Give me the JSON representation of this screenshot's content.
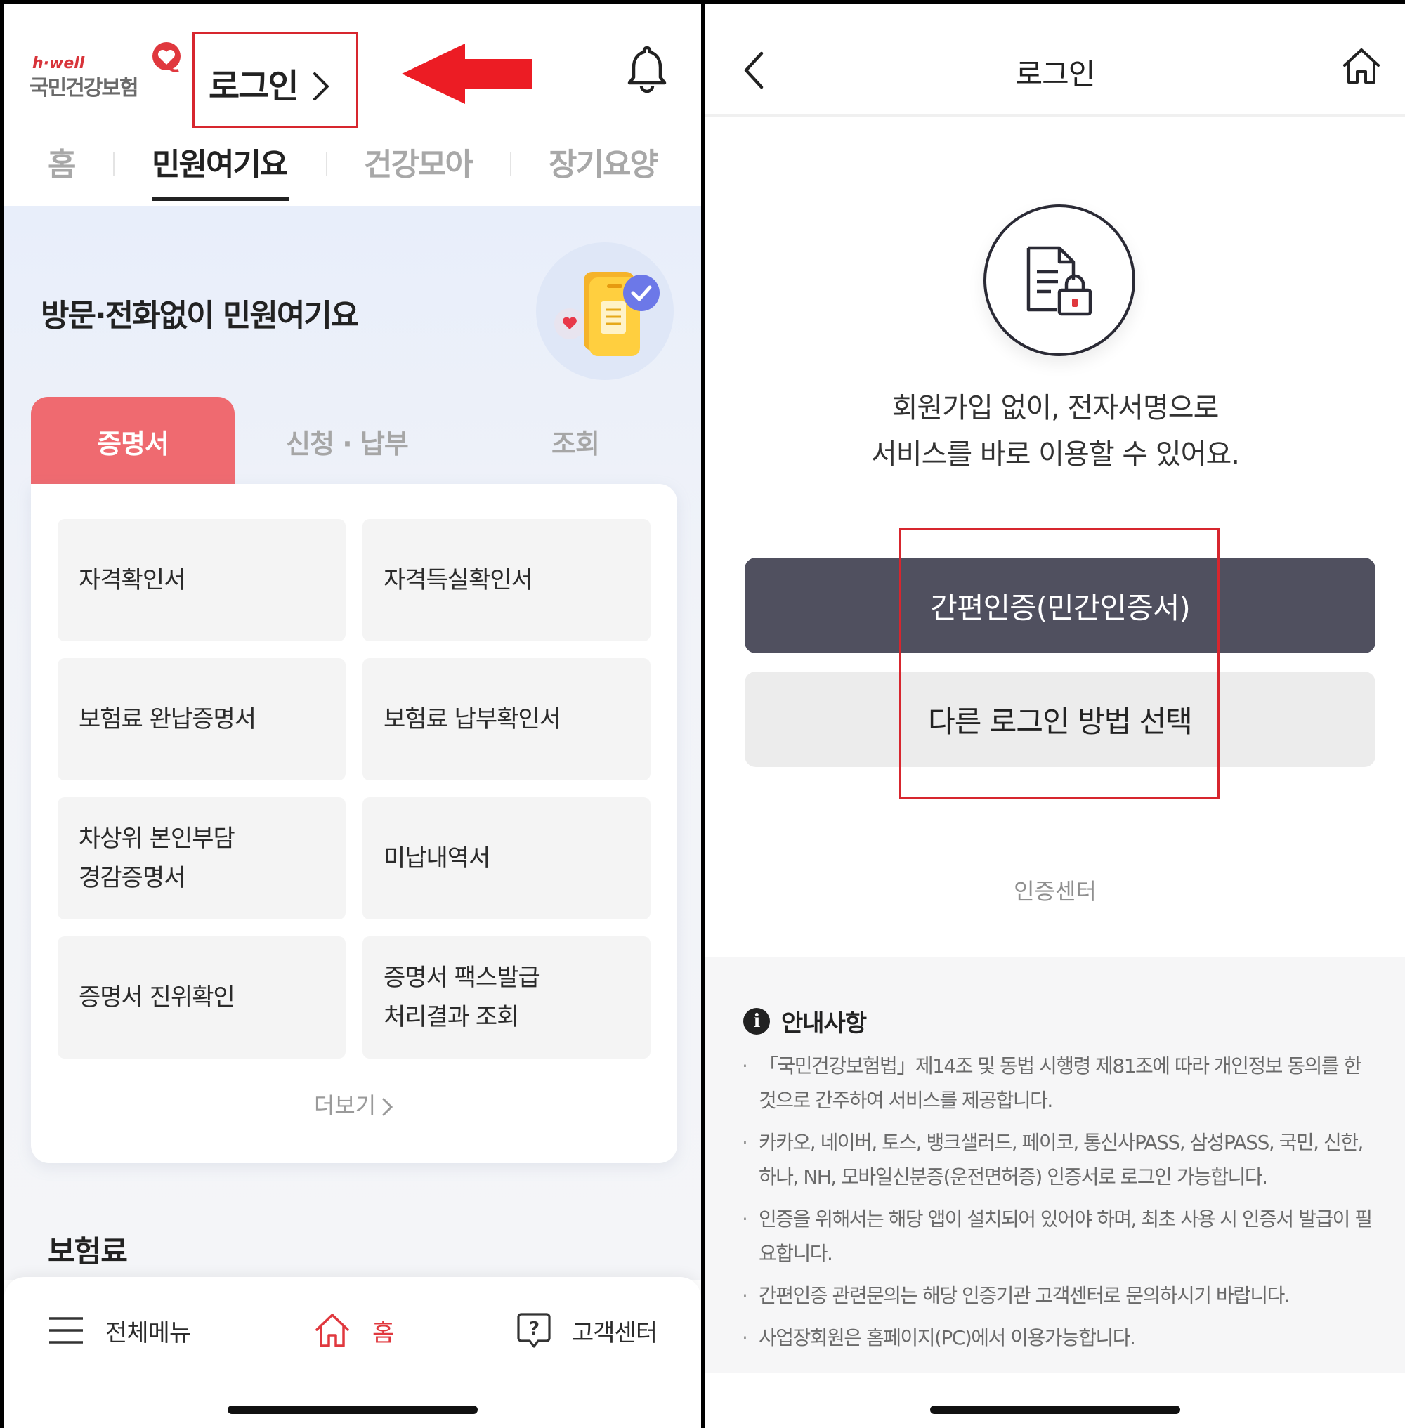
{
  "left": {
    "logo": {
      "brand_small": "h·well",
      "brand_name": "국민건강보험"
    },
    "login_link": {
      "label": "로그인"
    },
    "nav_tabs": [
      {
        "label": "홈"
      },
      {
        "label": "민원여기요"
      },
      {
        "label": "건강모아"
      },
      {
        "label": "장기요양"
      }
    ],
    "active_nav_tab": "민원여기요",
    "hero": {
      "title": "방문·전화없이 민원여기요"
    },
    "category_tabs": [
      {
        "label": "증명서"
      },
      {
        "label": "신청 · 납부"
      },
      {
        "label": "조회"
      }
    ],
    "active_category_tab": "증명서",
    "tiles": [
      {
        "label": "자격확인서"
      },
      {
        "label": "자격득실확인서"
      },
      {
        "label": "보험료 완납증명서"
      },
      {
        "label": "보험료 납부확인서"
      },
      {
        "label": "차상위 본인부담\n경감증명서"
      },
      {
        "label": "미납내역서"
      },
      {
        "label": "증명서 진위확인"
      },
      {
        "label": "증명서 팩스발급\n처리결과 조회"
      }
    ],
    "more_label": "더보기",
    "section_title": "보험료",
    "bottom_nav": [
      {
        "label": "전체메뉴",
        "icon": "hamburger-icon"
      },
      {
        "label": "홈",
        "icon": "home-icon"
      },
      {
        "label": "고객센터",
        "icon": "help-icon"
      }
    ],
    "colors": {
      "accent_red": "#ef6a70",
      "annotation_red": "#d7262e",
      "home_red": "#e0383e"
    }
  },
  "right": {
    "header": {
      "title": "로그인"
    },
    "description_line1": "회원가입 없이, 전자서명으로",
    "description_line2": "서비스를 바로 이용할 수 있어요.",
    "primary_button": "간편인증(민간인증서)",
    "secondary_button": "다른 로그인 방법 선택",
    "cert_center": "인증센터",
    "notice": {
      "title": "안내사항",
      "info_glyph": "i",
      "items": [
        "「국민건강보험법」제14조 및 동법 시행령 제81조에 따라 개인정보 동의를 한 것으로 간주하여 서비스를 제공합니다.",
        "카카오, 네이버, 토스, 뱅크샐러드, 페이코, 통신사PASS, 삼성PASS, 국민, 신한, 하나, NH, 모바일신분증(운전면허증) 인증서로 로그인 가능합니다.",
        "인증을 위해서는 해당 앱이 설치되어 있어야 하며, 최초 사용 시 인증서 발급이 필요합니다.",
        "간편인증 관련문의는 해당 인증기관 고객센터로 문의하시기 바랍니다.",
        "사업장회원은 홈페이지(PC)에서 이용가능합니다."
      ]
    },
    "colors": {
      "primary_button_bg": "#50505f",
      "secondary_button_bg": "#ececec"
    }
  }
}
